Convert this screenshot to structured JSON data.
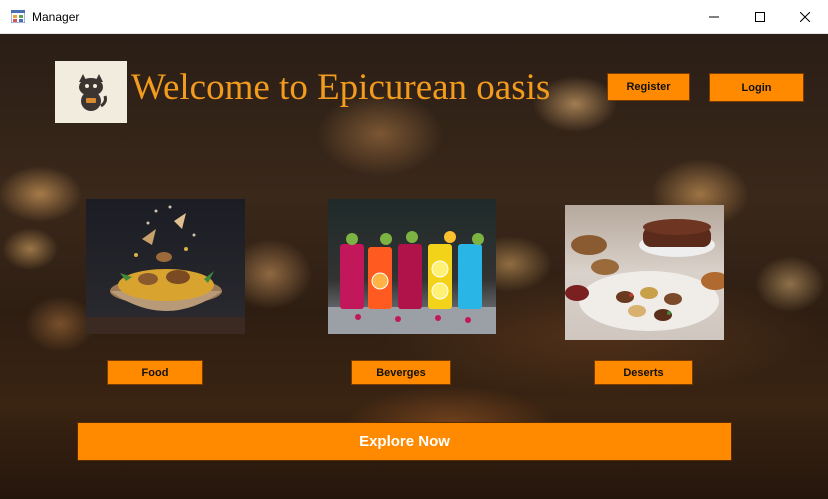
{
  "window": {
    "title": "Manager",
    "icon": "app-window-icon"
  },
  "header": {
    "logo_icon": "cat-icon",
    "welcome_text": "Welcome to Epicurean oasis",
    "register_label": "Register",
    "login_label": "Login"
  },
  "categories": [
    {
      "label": "Food",
      "image": "food-bowl-image"
    },
    {
      "label": "Beverges",
      "image": "drinks-glasses-image"
    },
    {
      "label": "Deserts",
      "image": "dessert-platter-image"
    }
  ],
  "explore_label": "Explore Now",
  "colors": {
    "accent": "#ff8a00",
    "title_text": "#f29b1c"
  }
}
